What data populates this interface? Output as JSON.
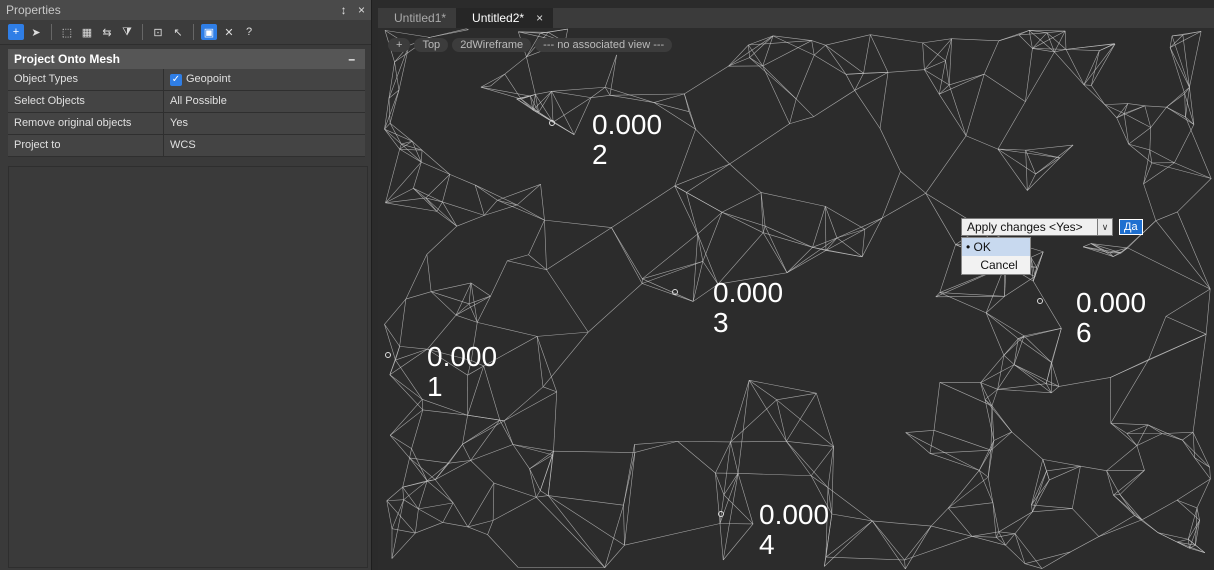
{
  "panel": {
    "title": "Properties",
    "pin_glyph": "↕",
    "close_glyph": "×",
    "group_title": "Project Onto Mesh",
    "collapse_glyph": "–",
    "rows": [
      {
        "key": "Object Types",
        "value": "Geopoint",
        "checked": true
      },
      {
        "key": "Select Objects",
        "value": "All Possible"
      },
      {
        "key": "Remove original objects",
        "value": "Yes"
      },
      {
        "key": "Project to",
        "value": "WCS"
      }
    ]
  },
  "tabs": [
    {
      "label": "Untitled1*",
      "active": false
    },
    {
      "label": "Untitled2*",
      "active": true,
      "close": "×"
    }
  ],
  "viewport": {
    "controls": [
      "+",
      "Top",
      "2dWireframe",
      "--- no associated view ---"
    ],
    "labels": [
      {
        "value": "0.000",
        "id": "2"
      },
      {
        "value": "0.000",
        "id": "3"
      },
      {
        "value": "0.000",
        "id": "6"
      },
      {
        "value": "0.000",
        "id": "1"
      },
      {
        "value": "0.000",
        "id": "4"
      }
    ]
  },
  "prompt": {
    "combo_text": "Apply changes <Yes>",
    "combo_arrow": "∨",
    "answer": "Да",
    "options": [
      {
        "label": "OK",
        "bullet": "•",
        "selected": true
      },
      {
        "label": "Cancel",
        "selected": false
      }
    ]
  },
  "colors": {
    "accent": "#2f7ee6",
    "mesh_line": "#cfcfcf",
    "background": "#2c2c2c"
  }
}
